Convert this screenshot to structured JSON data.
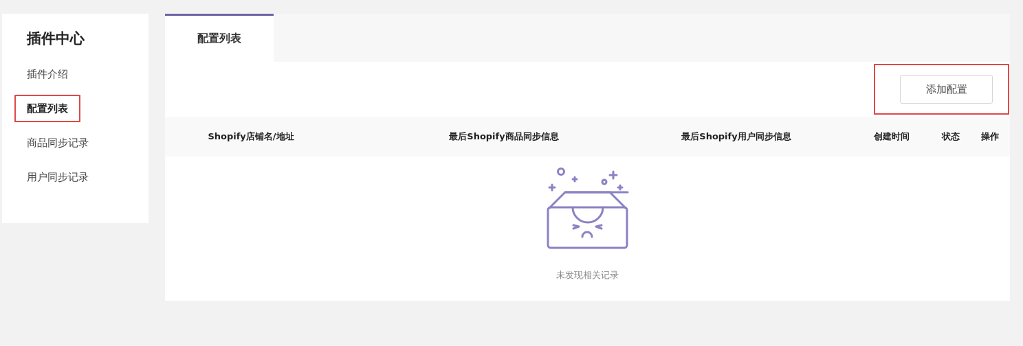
{
  "sidebar": {
    "title": "插件中心",
    "items": [
      {
        "label": "插件介绍",
        "selected": false,
        "highlighted": false
      },
      {
        "label": "配置列表",
        "selected": true,
        "highlighted": true
      },
      {
        "label": "商品同步记录",
        "selected": false,
        "highlighted": false
      },
      {
        "label": "用户同步记录",
        "selected": false,
        "highlighted": false
      }
    ]
  },
  "tabs": [
    {
      "label": "配置列表",
      "selected": true
    }
  ],
  "toolbar": {
    "highlighted": true,
    "add_button": "添加配置"
  },
  "table": {
    "columns": [
      "Shopify店铺名/地址",
      "最后Shopify商品同步信息",
      "最后Shopify用户同步信息",
      "创建时间",
      "状态",
      "操作"
    ],
    "empty_message": "未发现相关记录"
  }
}
